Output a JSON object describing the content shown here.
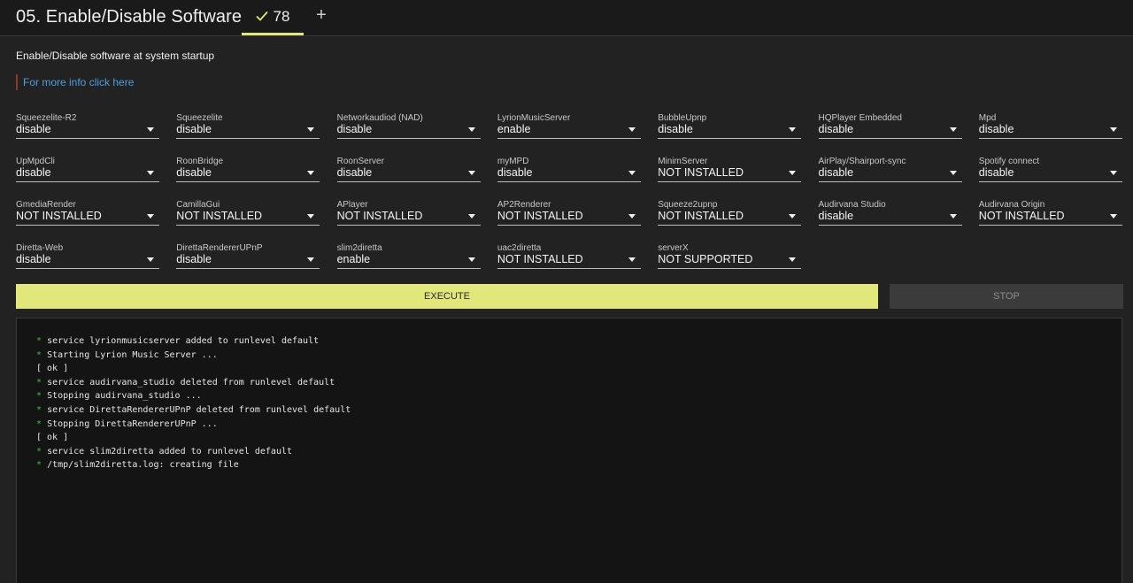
{
  "header": {
    "title": "05. Enable/Disable Software",
    "tab_check_label": "78",
    "add_tab_label": "+"
  },
  "subtitle": "Enable/Disable software at system startup",
  "info_link": "For more info click here",
  "fields": [
    {
      "label": "Squeezelite-R2",
      "value": "disable"
    },
    {
      "label": "Squeezelite",
      "value": "disable"
    },
    {
      "label": "Networkaudiod (NAD)",
      "value": "disable"
    },
    {
      "label": "LyrionMusicServer",
      "value": "enable"
    },
    {
      "label": "BubbleUpnp",
      "value": "disable"
    },
    {
      "label": "HQPlayer Embedded",
      "value": "disable"
    },
    {
      "label": "Mpd",
      "value": "disable"
    },
    {
      "label": "UpMpdCli",
      "value": "disable"
    },
    {
      "label": "RoonBridge",
      "value": "disable"
    },
    {
      "label": "RoonServer",
      "value": "disable"
    },
    {
      "label": "myMPD",
      "value": "disable"
    },
    {
      "label": "MinimServer",
      "value": "NOT INSTALLED"
    },
    {
      "label": "AirPlay/Shairport-sync",
      "value": "disable"
    },
    {
      "label": "Spotify connect",
      "value": "disable"
    },
    {
      "label": "GmediaRender",
      "value": "NOT INSTALLED"
    },
    {
      "label": "CamillaGui",
      "value": "NOT INSTALLED"
    },
    {
      "label": "APlayer",
      "value": "NOT INSTALLED"
    },
    {
      "label": "AP2Renderer",
      "value": "NOT INSTALLED"
    },
    {
      "label": "Squeeze2upnp",
      "value": "NOT INSTALLED"
    },
    {
      "label": "Audirvana Studio",
      "value": "disable"
    },
    {
      "label": "Audirvana Origin",
      "value": "NOT INSTALLED"
    },
    {
      "label": "Diretta-Web",
      "value": "disable"
    },
    {
      "label": "DirettaRendererUPnP",
      "value": "disable"
    },
    {
      "label": "slim2diretta",
      "value": "enable"
    },
    {
      "label": "uac2diretta",
      "value": "NOT INSTALLED"
    },
    {
      "label": "serverX",
      "value": "NOT SUPPORTED"
    }
  ],
  "buttons": {
    "execute": "EXECUTE",
    "stop": "STOP"
  },
  "console": [
    {
      "star": "*",
      "text": "service lyrionmusicserver added to runlevel default"
    },
    {
      "star": "*",
      "text": "Starting Lyrion Music Server ..."
    },
    {
      "star": "",
      "text": "[ ok ]"
    },
    {
      "star": "*",
      "text": "service audirvana_studio deleted from runlevel default"
    },
    {
      "star": "*",
      "text": "Stopping audirvana_studio ..."
    },
    {
      "star": "*",
      "text": "service DirettaRendererUPnP deleted from runlevel default"
    },
    {
      "star": "*",
      "text": "Stopping DirettaRendererUPnP ..."
    },
    {
      "star": "",
      "text": "[ ok ]"
    },
    {
      "star": "*",
      "text": "service slim2diretta added to runlevel default"
    },
    {
      "star": "*",
      "text": "/tmp/slim2diretta.log: creating file"
    }
  ],
  "colors": {
    "accent": "#e1e77a",
    "link": "#4a9fe0",
    "console_star": "#3fbf3f"
  }
}
